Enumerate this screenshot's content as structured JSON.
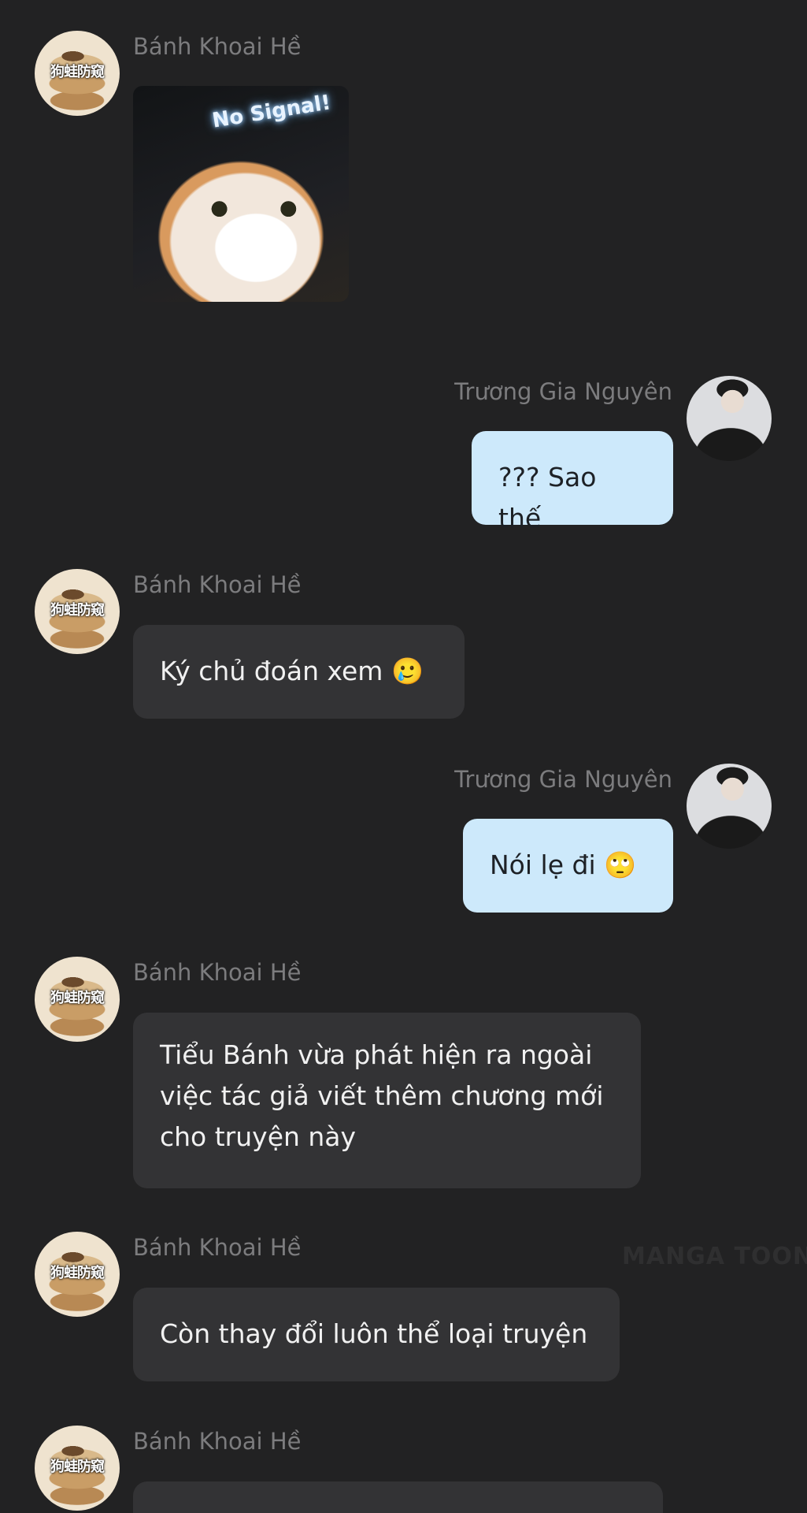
{
  "messages": [
    {
      "sender": "Bánh Khoai Hề",
      "type": "sticker",
      "sticker_text": "No Signal!"
    },
    {
      "sender": "Trương Gia Nguyên",
      "type": "text",
      "text": "??? Sao thế"
    },
    {
      "sender": "Bánh Khoai Hề",
      "type": "text",
      "text": "Ký chủ đoán xem 🥲"
    },
    {
      "sender": "Trương Gia Nguyên",
      "type": "text",
      "text": "Nói lẹ đi 🙄"
    },
    {
      "sender": "Bánh Khoai Hề",
      "type": "text",
      "text": "Tiểu Bánh vừa phát hiện ra ngoài\nviệc tác giả viết thêm chương mới\ncho truyện này"
    },
    {
      "sender": "Bánh Khoai Hề",
      "type": "text",
      "text": "Còn thay đổi luôn thể loại truyện"
    },
    {
      "sender": "Bánh Khoai Hề",
      "type": "text",
      "text": ""
    }
  ],
  "avatar_watermark": "狗蛙防窥",
  "watermark": "MANGA TOON",
  "colors": {
    "background": "#222223",
    "left_bubble": "#333335",
    "right_bubble": "#cde9fb",
    "name_text": "#7c7c7e"
  }
}
